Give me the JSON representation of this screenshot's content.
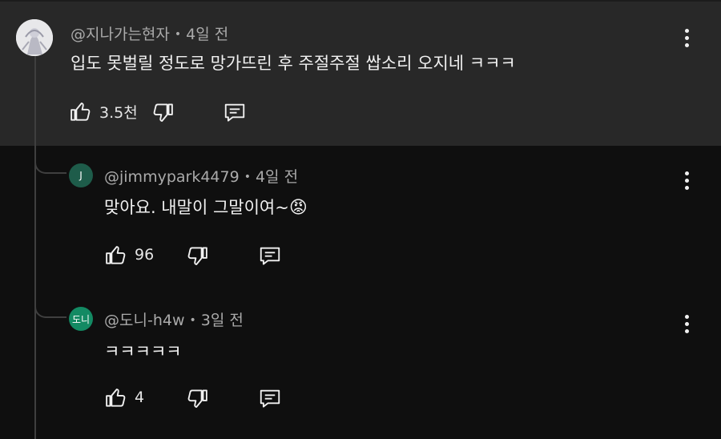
{
  "comments": [
    {
      "author": "@지나가는현자",
      "time": "4일 전",
      "text": "입도 못벌릴 정도로 망가뜨린 후 주절주절 쌉소리 오지네 ㅋㅋㅋ",
      "likes": "3.5천",
      "avatar_icon": "anime-character-avatar"
    },
    {
      "author": "@jimmypark4479",
      "time": "4일 전",
      "text": "맞아요. 내말이 그말이여~",
      "emoji": "😡",
      "likes": "96",
      "avatar_letter": "J",
      "avatar_color": "#1e5c4a"
    },
    {
      "author": "@도니-h4w",
      "time": "3일 전",
      "text": "ㅋㅋㅋㅋㅋ",
      "likes": "4",
      "avatar_letter": "도니",
      "avatar_color": "#138a63"
    }
  ],
  "colors": {
    "top_background": "#282828",
    "page_background": "#0f0f0f",
    "meta_text": "#aaaaaa"
  }
}
